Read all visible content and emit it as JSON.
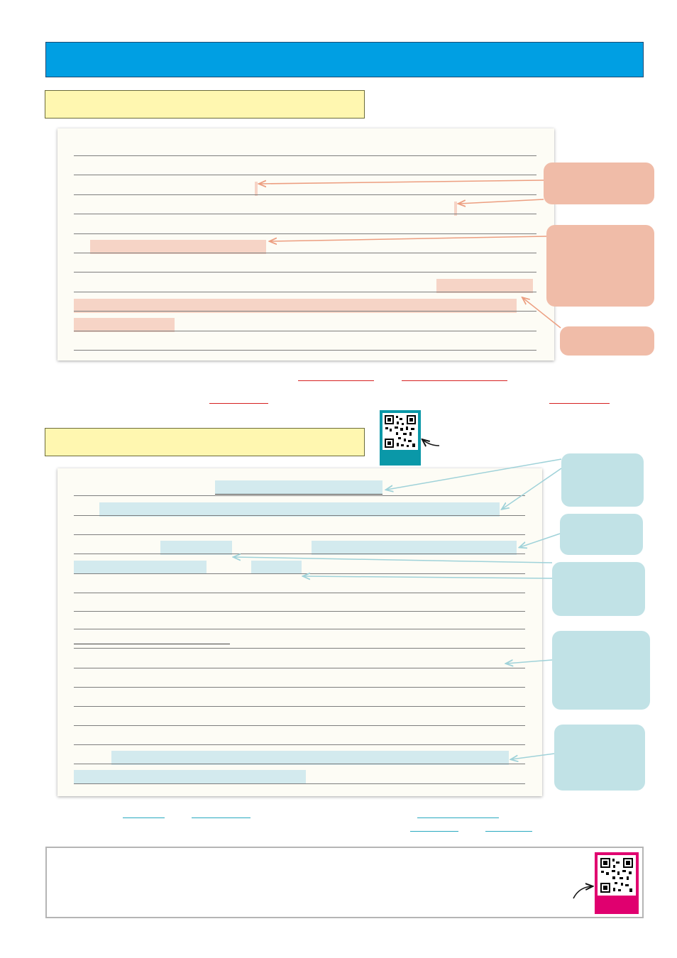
{
  "header": {
    "title": ""
  },
  "section1": {
    "heading": ""
  },
  "section2": {
    "heading": ""
  },
  "qr_codes": [
    {
      "icon": "qr-code-icon",
      "color": "#0a98a8"
    },
    {
      "icon": "qr-code-icon",
      "color": "#e0006f"
    }
  ],
  "colors": {
    "header_blue": "#009fe3",
    "heading_yellow": "#fff7b0",
    "highlight_peach": "#f6d4c6",
    "highlight_blue": "#d3eaee",
    "callout_peach": "#f0bca8",
    "callout_blue": "#c1e2e6",
    "underline_red": "#d62020",
    "underline_blue": "#29a9c0"
  },
  "note": {
    "text": ""
  }
}
